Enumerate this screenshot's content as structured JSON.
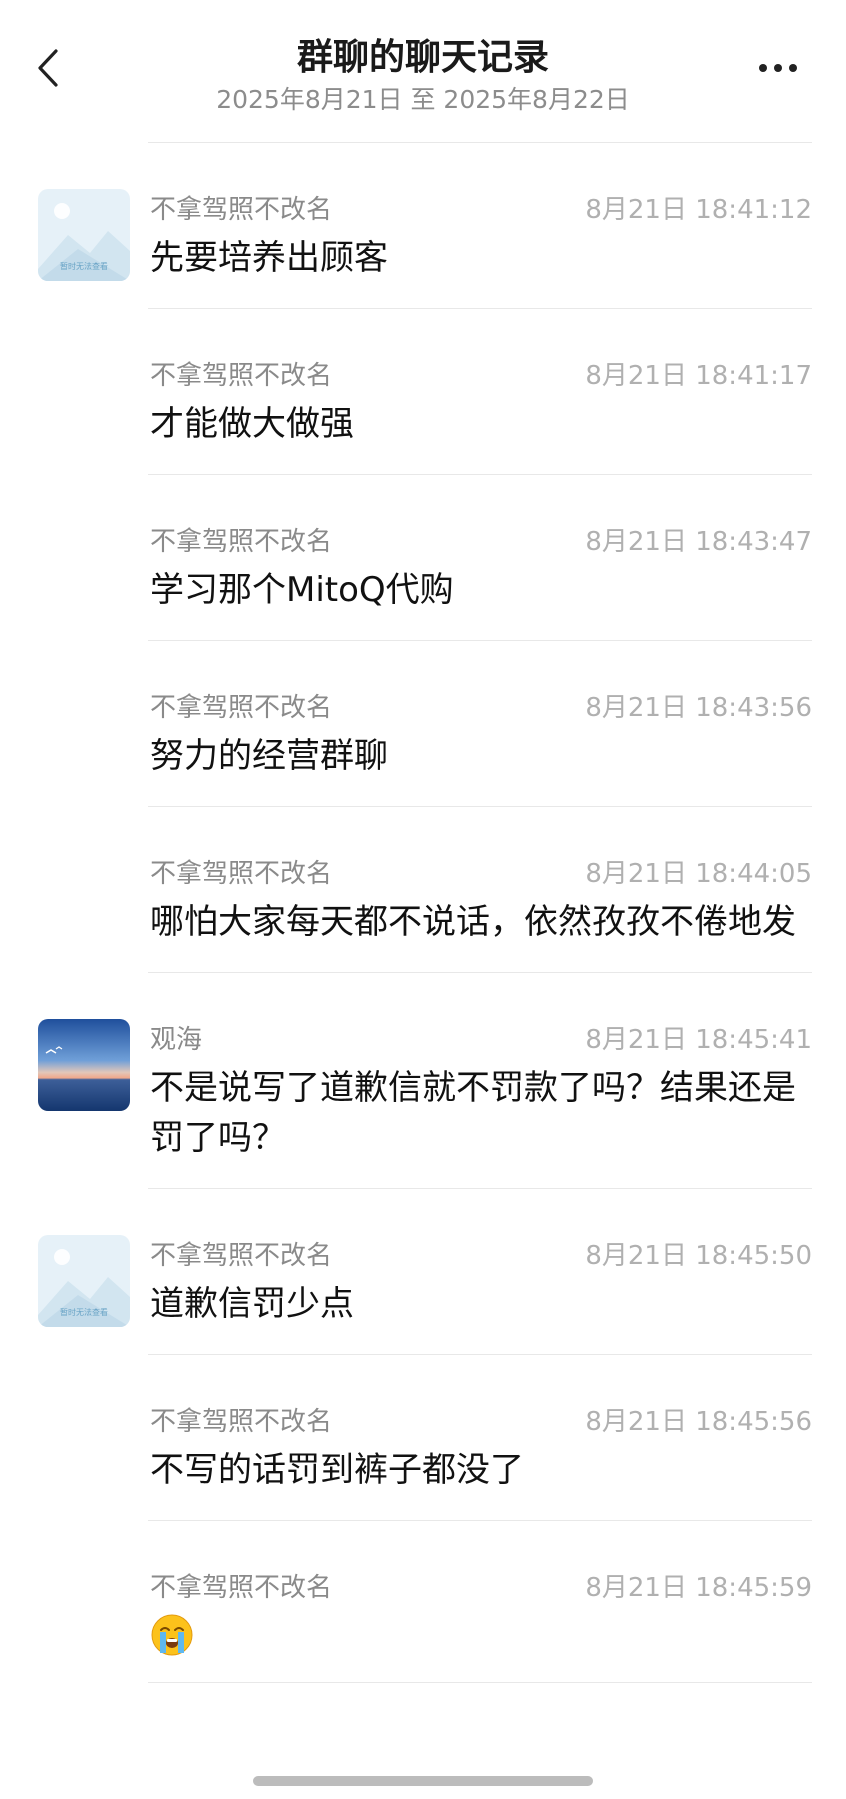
{
  "header": {
    "title": "群聊的聊天记录",
    "date_range": "2025年8月21日 至 2025年8月22日",
    "back_icon": "chevron-left-icon",
    "more_icon": "more-horizontal-icon"
  },
  "avatars": {
    "placeholder": {
      "icon": "image-placeholder-icon",
      "caption": "暂时无法查看"
    },
    "seaview": {
      "icon": "sea-sunset-photo"
    }
  },
  "messages": [
    {
      "sender": "不拿驾照不改名",
      "time": "8月21日 18:41:12",
      "text": "先要培养出顾客",
      "avatar": "placeholder"
    },
    {
      "sender": "不拿驾照不改名",
      "time": "8月21日 18:41:17",
      "text": "才能做大做强",
      "avatar": ""
    },
    {
      "sender": "不拿驾照不改名",
      "time": "8月21日 18:43:47",
      "text": "学习那个MitoQ代购",
      "avatar": ""
    },
    {
      "sender": "不拿驾照不改名",
      "time": "8月21日 18:43:56",
      "text": "努力的经营群聊",
      "avatar": ""
    },
    {
      "sender": "不拿驾照不改名",
      "time": "8月21日 18:44:05",
      "text": "哪怕大家每天都不说话，依然孜孜不倦地发",
      "avatar": ""
    },
    {
      "sender": "观海",
      "time": "8月21日 18:45:41",
      "text": "不是说写了道歉信就不罚款了吗？结果还是罚了吗？",
      "avatar": "seaview"
    },
    {
      "sender": "不拿驾照不改名",
      "time": "8月21日 18:45:50",
      "text": "道歉信罚少点",
      "avatar": "placeholder"
    },
    {
      "sender": "不拿驾照不改名",
      "time": "8月21日 18:45:56",
      "text": "不写的话罚到裤子都没了",
      "avatar": ""
    },
    {
      "sender": "不拿驾照不改名",
      "time": "8月21日 18:45:59",
      "text": "",
      "emoji": "loudly-crying-face-emoji",
      "avatar": ""
    }
  ],
  "colors": {
    "sender": "#8a8a8a",
    "time": "#b0b0b0",
    "text": "#111111",
    "divider": "#e8e8e8"
  }
}
